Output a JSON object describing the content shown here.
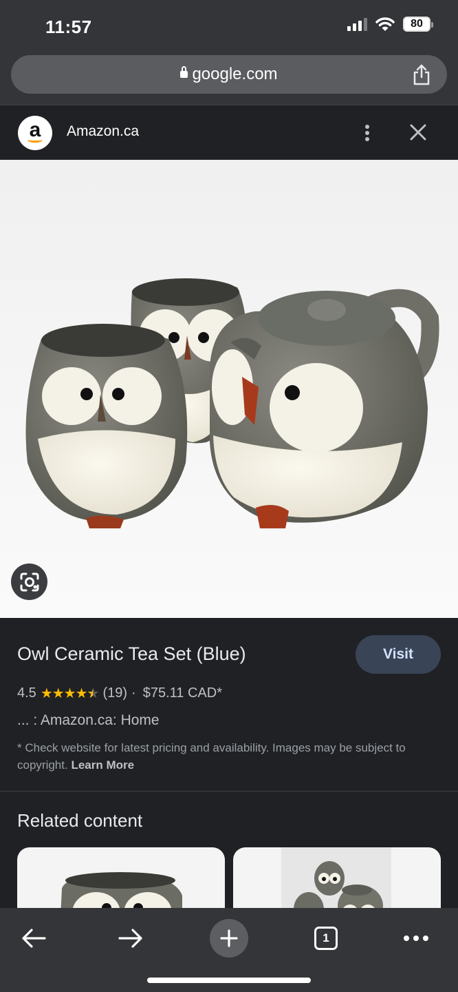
{
  "status_bar": {
    "time": "11:57",
    "battery": "80"
  },
  "browser": {
    "url": "google.com"
  },
  "source": {
    "logo_letter": "a",
    "name": "Amazon.ca"
  },
  "product": {
    "title": "Owl Ceramic Tea Set (Blue)",
    "visit_label": "Visit",
    "rating": "4.5",
    "rating_value": 4.5,
    "review_count": "(19)",
    "separator": "·",
    "price": "$75.11 CAD*",
    "breadcrumb": "... : Amazon.ca: Home",
    "disclaimer": "* Check website for latest pricing and availability. Images may be subject to copyright.",
    "learn_more": "Learn More"
  },
  "related": {
    "title": "Related content"
  },
  "toolbar": {
    "tab_count": "1"
  },
  "colors": {
    "star": "#fbbc04",
    "visit_bg": "#394457",
    "amazon_orange": "#ff9900",
    "page_bg": "#202124"
  }
}
